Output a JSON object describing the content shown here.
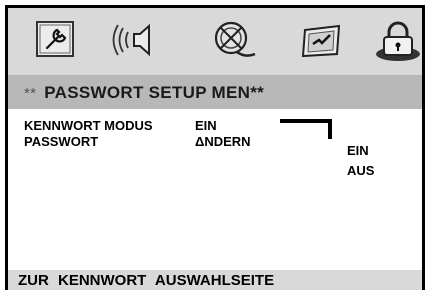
{
  "tabs": [
    {
      "name": "system-setup",
      "icon": "wrench-icon"
    },
    {
      "name": "audio-setup",
      "icon": "speaker-icon"
    },
    {
      "name": "video-setup",
      "icon": "film-reel-icon"
    },
    {
      "name": "preference-setup",
      "icon": "check-screen-icon"
    },
    {
      "name": "password-setup",
      "icon": "padlock-icon"
    }
  ],
  "title": {
    "stars": "**",
    "text": "PASSWORT SETUP MEN**"
  },
  "rows": {
    "mode_label": "KENNWORT MODUS",
    "mode_value": "EIN",
    "password_label": "PASSWORT",
    "password_value": "ΔNDERN"
  },
  "submenu": {
    "option1": "EIN",
    "option2": "AUS"
  },
  "footer": {
    "text": "ZUR KENNWORT AUSWAHLSEITE"
  },
  "colors": {
    "tabbar": "#d9d9d9",
    "titlebar": "#b8b8b8",
    "footer": "#d9d9d9"
  }
}
